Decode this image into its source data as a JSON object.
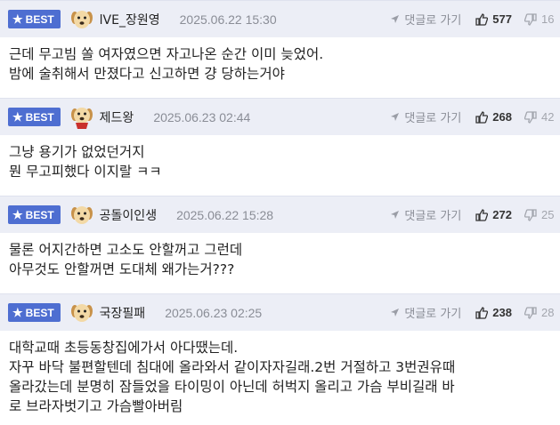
{
  "ui": {
    "best_label": "BEST",
    "reply_label": "댓글로 가기"
  },
  "comments": [
    {
      "nickname": "lVE_장원영",
      "date": "2025.06.22 15:30",
      "likes": "577",
      "dislikes": "16",
      "lines": [
        "근데 무고빔 쏠 여자였으면 자고나온 순간 이미 늦었어.",
        "밤에 술취해서 만졌다고 신고하면 걍 당하는거야"
      ]
    },
    {
      "nickname": "제드왕",
      "date": "2025.06.23 02:44",
      "likes": "268",
      "dislikes": "42",
      "lines": [
        "그냥 용기가 없었던거지",
        "뭔 무고피했다 이지랄 ㅋㅋ"
      ]
    },
    {
      "nickname": "공돌이인생",
      "date": "2025.06.22 15:28",
      "likes": "272",
      "dislikes": "25",
      "lines": [
        "물론 어지간하면 고소도 안할꺼고 그런데",
        "아무것도 안할꺼면 도대체 왜가는거???"
      ]
    },
    {
      "nickname": "국장필패",
      "date": "2025.06.23 02:25",
      "likes": "238",
      "dislikes": "28",
      "lines": [
        "대학교때 초등동창집에가서 아다땠는데.",
        "자꾸 바닥 불편할텐데 침대에 올라와서 같이자자길래.2번 거절하고 3번권유때",
        "올라갔는데 분명히 잠들었을 타이밍이 아닌데 허벅지 올리고 가슴 부비길래 바",
        "로 브라자벗기고 가슴빨아버림"
      ]
    }
  ]
}
